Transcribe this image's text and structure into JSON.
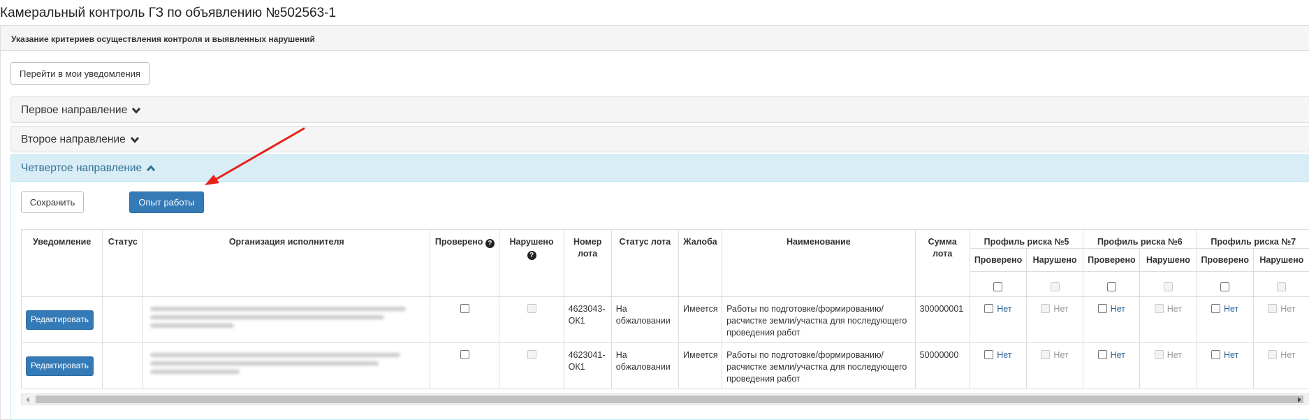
{
  "page": {
    "title": "Камеральный контроль ГЗ по объявлению №502563-1"
  },
  "criteria": {
    "header": "Указание критериев осуществления контроля и выявленных нарушений",
    "go_notifications_label": "Перейти в мои уведомления"
  },
  "accordion": {
    "first": "Первое направление",
    "second": "Второе направление",
    "fourth": "Четвертое направление"
  },
  "fourth": {
    "save_label": "Сохранить",
    "experience_label": "Опыт работы"
  },
  "table": {
    "headers": {
      "notification": "Уведомление",
      "status": "Статус",
      "org": "Организация исполнителя",
      "checked": "Проверено",
      "violated": "Нарушено",
      "lot_no": "Номер лота",
      "lot_status": "Статус лота",
      "complaint": "Жалоба",
      "name": "Наименование",
      "amount": "Сумма лота",
      "risk5": "Профиль риска №5",
      "risk6": "Профиль риска №6",
      "risk7": "Профиль риска №7"
    },
    "sub": {
      "checked": "Проверено",
      "violated": "Нарушено"
    },
    "rows": [
      {
        "edit_label": "Редактировать",
        "lot_no": "4623043-ОК1",
        "lot_status": "На обжаловании",
        "complaint": "Имеется",
        "name": "Работы по подготовке/формированию/расчистке земли/участка для последующего проведения работ",
        "amount": "300000001",
        "no_label": "Нет"
      },
      {
        "edit_label": "Редактировать",
        "lot_no": "4623041-ОК1",
        "lot_status": "На обжаловании",
        "complaint": "Имеется",
        "name": "Работы по подготовке/формированию/расчистке земли/участка для последующего проведения работ",
        "amount": "50000000",
        "no_label": "Нет"
      }
    ]
  },
  "colors": {
    "primary": "#337ab7",
    "accordion_active_bg": "#d9edf7",
    "accordion_active_text": "#31708f",
    "annotation_arrow": "#e8221b"
  },
  "icons": {
    "chevron_down": "chevron-down-icon",
    "chevron_up": "chevron-up-icon",
    "help": "question-circle-icon",
    "annotation": "red-arrow-annotation"
  }
}
